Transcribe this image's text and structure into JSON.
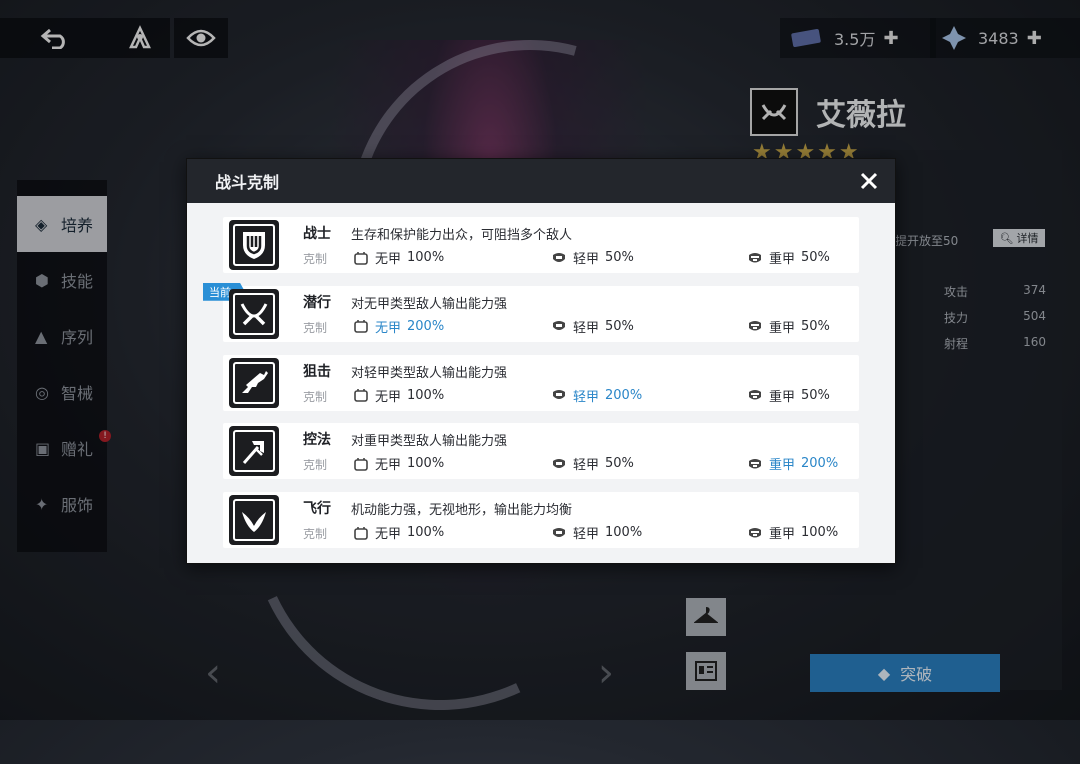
{
  "top_bar": {
    "back_icon": "back-arrow-icon",
    "rank_icon": "rank-emblem-icon",
    "eye_icon": "eye-icon",
    "currency_1": {
      "icon": "ticket-icon",
      "value": "3.5万",
      "add_icon": "plus-icon"
    },
    "currency_2": {
      "icon": "crystal-icon",
      "value": "3483",
      "add_icon": "plus-icon"
    }
  },
  "side_menu": {
    "items": [
      {
        "label": "培养",
        "icon": "diamond-icon",
        "active": true
      },
      {
        "label": "技能",
        "icon": "skill-icon",
        "active": false
      },
      {
        "label": "序列",
        "icon": "triangle-icon",
        "active": false
      },
      {
        "label": "智械",
        "icon": "mech-icon",
        "active": false
      },
      {
        "label": "赠礼",
        "icon": "gift-icon",
        "active": false,
        "badge": "!"
      },
      {
        "label": "服饰",
        "icon": "outfit-icon",
        "active": false
      }
    ]
  },
  "character": {
    "name": "艾薇拉",
    "stars": "★★★★★",
    "level_hint": "提开放至50",
    "detail_button": "详情",
    "stats": [
      {
        "name": "攻击",
        "value": "374"
      },
      {
        "name": "技力",
        "value": "504"
      },
      {
        "name": "射程",
        "value": "160"
      }
    ],
    "breakthrough_button": "突破"
  },
  "modal": {
    "title": "战斗克制",
    "close_icon": "close-icon",
    "counter_label": "克制",
    "current_tag": "当前",
    "armor_types": {
      "none": "无甲",
      "light": "轻甲",
      "heavy": "重甲"
    },
    "roles": [
      {
        "name": "战士",
        "icon": "shield-icon",
        "desc": "生存和保护能力出众，可阻挡多个敌人",
        "none_pct": "100%",
        "light_pct": "50%",
        "heavy_pct": "50%",
        "highlight": ""
      },
      {
        "name": "潜行",
        "icon": "crossed-blades-icon",
        "desc": "对无甲类型敌人输出能力强",
        "none_pct": "200%",
        "light_pct": "50%",
        "heavy_pct": "50%",
        "highlight": "none",
        "current": true
      },
      {
        "name": "狙击",
        "icon": "rifle-icon",
        "desc": "对轻甲类型敌人输出能力强",
        "none_pct": "100%",
        "light_pct": "200%",
        "heavy_pct": "50%",
        "highlight": "light"
      },
      {
        "name": "控法",
        "icon": "staff-icon",
        "desc": "对重甲类型敌人输出能力强",
        "none_pct": "100%",
        "light_pct": "50%",
        "heavy_pct": "200%",
        "highlight": "heavy"
      },
      {
        "name": "飞行",
        "icon": "wings-icon",
        "desc": "机动能力强，无视地形，输出能力均衡",
        "none_pct": "100%",
        "light_pct": "100%",
        "heavy_pct": "100%",
        "highlight": ""
      }
    ]
  },
  "colors": {
    "highlight": "#2a86c8",
    "header_bg": "#23262c",
    "current_tag": "#2a8fd6",
    "breakthrough": "#2a7fc0"
  }
}
